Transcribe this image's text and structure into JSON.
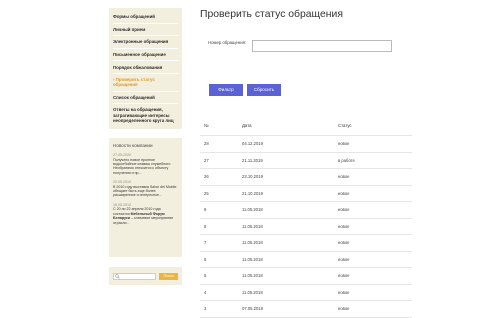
{
  "sidebar": {
    "items": [
      {
        "label": "Формы обращений",
        "active": false
      },
      {
        "label": "Личный прием",
        "active": false
      },
      {
        "label": "Электронные обращения",
        "active": false
      },
      {
        "label": "Письменное обращение",
        "active": false
      },
      {
        "label": "Порядок обжалования",
        "active": false
      },
      {
        "label": "› Проверить статус обращения",
        "active": true
      },
      {
        "label": "Список обращений",
        "active": false
      },
      {
        "label": "Ответы на обращения, затрагивающие интересы неопределенного круга лиц",
        "active": false
      }
    ]
  },
  "news": {
    "heading": "Новости компании",
    "items": [
      {
        "date": "27.05.2020",
        "text": "Получено новое пропное водоотбойное клавиш служебного Необратимо относится к объекту получения и пр..."
      },
      {
        "date": "20.05.2010",
        "text": "В 2010 году выставка Salon del Mobile обещает быть еще более расширенное и интересное..."
      },
      {
        "date": "16.05.2010",
        "text_prefix": "С 20 по 22 апреля 2010 года состоится ",
        "text_bold": "Мебельный Форум Беларуси",
        "text_suffix": " – ключевое мероприятие отрасли..."
      }
    ]
  },
  "search": {
    "placeholder": "",
    "button_label": "Поиск"
  },
  "main": {
    "title": "Проверить статус обращения",
    "field_label": "Номер обращения:",
    "field_value": "",
    "filter_label": "Фильтр",
    "reset_label": "Сбросить"
  },
  "table": {
    "headers": [
      "№",
      "Дата",
      "Статус"
    ],
    "rows": [
      [
        "28",
        "04.12.2019",
        "новое"
      ],
      [
        "27",
        "21.11.2019",
        "в работе"
      ],
      [
        "26",
        "23.10.2019",
        "новое"
      ],
      [
        "25",
        "21.10.2019",
        "новое"
      ],
      [
        "9",
        "11.05.2018",
        "новое"
      ],
      [
        "8",
        "11.05.2018",
        "новое"
      ],
      [
        "7",
        "11.05.2018",
        "новое"
      ],
      [
        "6",
        "11.05.2018",
        "новое"
      ],
      [
        "5",
        "11.05.2018",
        "новое"
      ],
      [
        "4",
        "11.05.2018",
        "новое"
      ],
      [
        "3",
        "07.05.2018",
        "новое"
      ]
    ]
  },
  "colors": {
    "panel": "#f3efdf",
    "active_link": "#d99a2b",
    "button": "#5b62d6",
    "search_button": "#f1b43a"
  }
}
